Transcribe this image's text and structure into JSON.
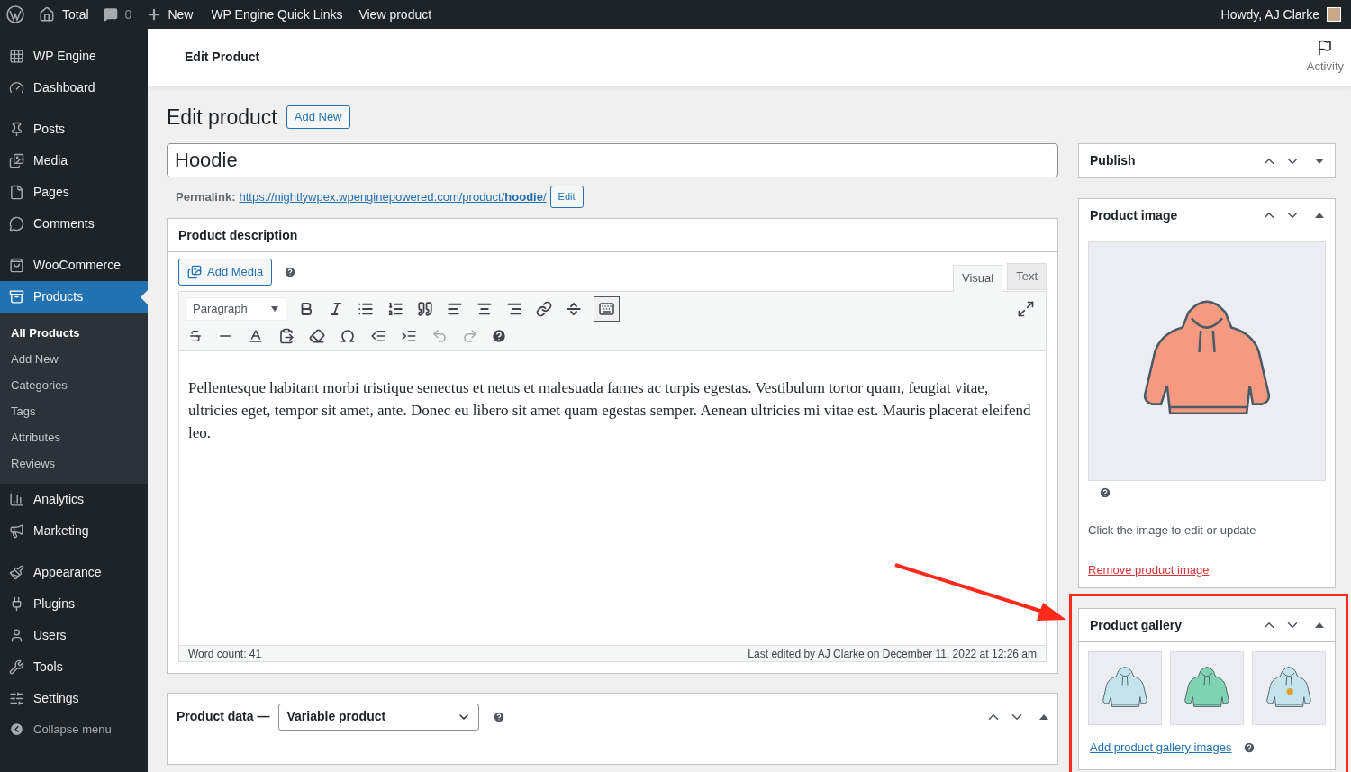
{
  "admin_bar": {
    "items": [
      {
        "kind": "logo"
      },
      {
        "kind": "home",
        "label": "Total"
      },
      {
        "kind": "comments",
        "label": "0"
      },
      {
        "kind": "new",
        "label": "New"
      },
      {
        "kind": "link",
        "label": "WP Engine Quick Links"
      },
      {
        "kind": "link",
        "label": "View product"
      }
    ],
    "greeting": "Howdy, AJ Clarke"
  },
  "sidebar": {
    "groups": [
      {
        "items": [
          {
            "label": "WP Engine",
            "selected": false
          },
          {
            "label": "Dashboard",
            "selected": false
          }
        ]
      },
      {
        "items": [
          {
            "label": "Posts",
            "selected": false
          },
          {
            "label": "Media",
            "selected": false
          },
          {
            "label": "Pages",
            "selected": false
          },
          {
            "label": "Comments",
            "selected": false
          }
        ]
      },
      {
        "items": [
          {
            "label": "WooCommerce",
            "selected": false
          },
          {
            "label": "Products",
            "selected": true,
            "children": [
              {
                "label": "All Products",
                "selected": true
              },
              {
                "label": "Add New",
                "selected": false
              },
              {
                "label": "Categories",
                "selected": false
              },
              {
                "label": "Tags",
                "selected": false
              },
              {
                "label": "Attributes",
                "selected": false
              },
              {
                "label": "Reviews",
                "selected": false
              }
            ]
          },
          {
            "label": "Analytics",
            "selected": false
          },
          {
            "label": "Marketing",
            "selected": false
          }
        ]
      },
      {
        "items": [
          {
            "label": "Appearance",
            "selected": false
          },
          {
            "label": "Plugins",
            "selected": false
          },
          {
            "label": "Users",
            "selected": false
          },
          {
            "label": "Tools",
            "selected": false
          },
          {
            "label": "Settings",
            "selected": false
          }
        ]
      }
    ],
    "collapse_label": "Collapse menu"
  },
  "header": {
    "title": "Edit Product",
    "activity": "Activity"
  },
  "page": {
    "title": "Edit product",
    "add_new": "Add New",
    "product_title": "Hoodie",
    "permalink_label": "Permalink:",
    "permalink_url": "https://nightlywpex.wpenginepowered.com/product/**hoodie**/",
    "permalink_edit": "Edit"
  },
  "description": {
    "title": "Product description",
    "add_media": "Add Media",
    "tabs": [
      {
        "label": "Visual",
        "selected": true
      },
      {
        "label": "Text",
        "selected": false
      }
    ],
    "format": "Paragraph",
    "toolbar_toggle_pressed": true,
    "content": "Pellentesque habitant morbi tristique senectus et netus et malesuada fames ac turpis egestas. Vestibulum tortor quam, feugiat vitae, ultricies eget, tempor sit amet, ante. Donec eu libero sit amet quam egestas semper. Aenean ultricies mi vitae est. Mauris placerat eleifend leo.",
    "word_count": "Word count: 41",
    "last_edited": "Last edited by AJ Clarke on December 11, 2022 at 12:26 am"
  },
  "product_data": {
    "label": "Product data —",
    "type": "Variable product"
  },
  "side_panels": [
    {
      "kind": "publish",
      "title": "Publish",
      "expanded": false
    },
    {
      "kind": "image",
      "title": "Product image",
      "expanded": true,
      "hint": "Click the image to edit or update",
      "link": "Remove product image"
    },
    {
      "kind": "gallery",
      "title": "Product gallery",
      "expanded": true,
      "highlighted": true,
      "images": [
        {
          "color": "#c4e3ea"
        },
        {
          "color": "#7fd3b2"
        },
        {
          "color": "#c4e3ea"
        }
      ],
      "link": "Add product gallery images"
    }
  ]
}
